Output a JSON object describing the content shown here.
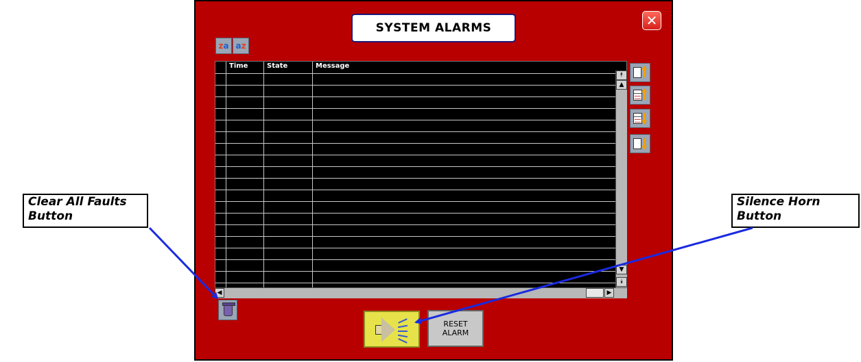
{
  "window": {
    "title": "SYSTEM ALARMS",
    "close_icon": "close-icon"
  },
  "grid": {
    "columns": [
      "",
      "Time",
      "State",
      "Message"
    ],
    "row_count": 19
  },
  "toolbar": {
    "sort_icons": [
      "sort-a-icon",
      "sort-b-icon"
    ],
    "nav_icons": [
      "page-up-first-icon",
      "scroll-up-icon",
      "scroll-down-icon",
      "page-down-last-icon"
    ]
  },
  "buttons": {
    "clear_all_icon": "trash-icon",
    "silence_horn_icon": "speaker-icon",
    "reset_alarm_line1": "RESET",
    "reset_alarm_line2": "ALARM"
  },
  "callouts": {
    "clear_all_faults_line1": "Clear All Faults",
    "clear_all_faults_line2": "Button",
    "silence_horn_line1": "Silence Horn",
    "silence_horn_line2": "Button"
  },
  "colors": {
    "panel": "#b80000",
    "grid_background": "#000000",
    "horn_button": "#e7e24a",
    "callout_arrow": "#1a2ae0"
  }
}
